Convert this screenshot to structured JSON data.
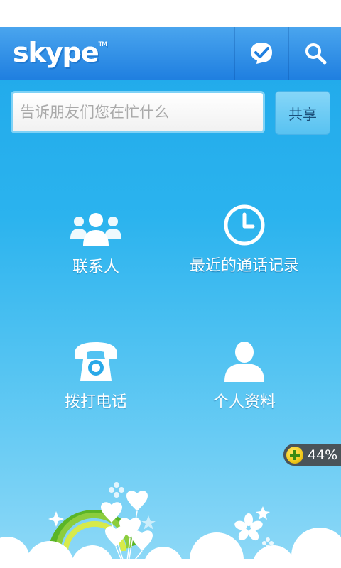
{
  "header": {
    "logo_text": "skype",
    "logo_tm": "TM",
    "status_icon": "check-bubble-icon",
    "search_icon": "search-icon"
  },
  "share": {
    "placeholder": "告诉朋友们您在忙什么",
    "button_label": "共享"
  },
  "tiles": [
    {
      "label": "联系人",
      "icon": "contacts-icon"
    },
    {
      "label": "最近的通话记录",
      "icon": "clock-icon"
    },
    {
      "label": "拨打电话",
      "icon": "phone-icon"
    },
    {
      "label": "个人资料",
      "icon": "profile-icon"
    }
  ],
  "battery_widget": {
    "percent_text": "44%"
  },
  "colors": {
    "header_top": "#4aa5ee",
    "header_bottom": "#1f7fe0",
    "background_top": "#1fa8ea",
    "background_bottom": "#8fd9f7"
  }
}
